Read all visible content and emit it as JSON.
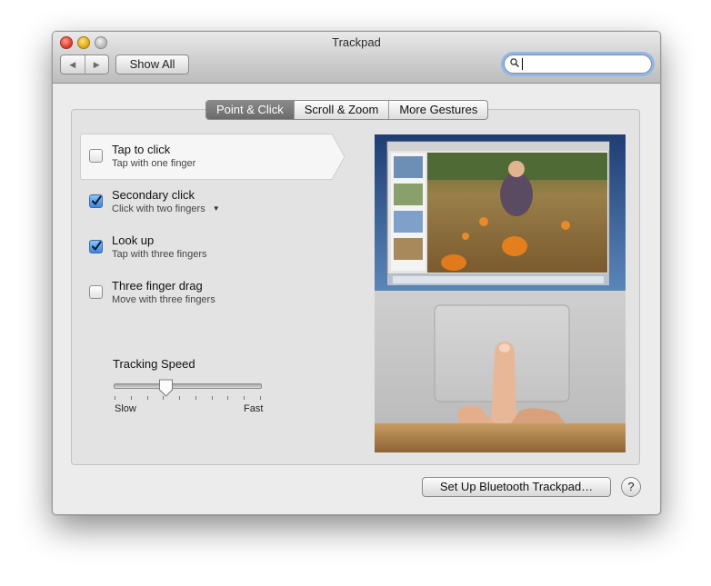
{
  "window": {
    "title": "Trackpad"
  },
  "toolbar": {
    "back_label": "◀",
    "forward_label": "▶",
    "show_all_label": "Show All",
    "search_value": "",
    "search_placeholder": ""
  },
  "tabs": [
    {
      "label": "Point & Click",
      "selected": true
    },
    {
      "label": "Scroll & Zoom",
      "selected": false
    },
    {
      "label": "More Gestures",
      "selected": false
    }
  ],
  "options": [
    {
      "title": "Tap to click",
      "subtitle": "Tap with one finger",
      "checked": false,
      "has_dropdown": false
    },
    {
      "title": "Secondary click",
      "subtitle": "Click with two fingers",
      "checked": true,
      "has_dropdown": true
    },
    {
      "title": "Look up",
      "subtitle": "Tap with three fingers",
      "checked": true,
      "has_dropdown": false
    },
    {
      "title": "Three finger drag",
      "subtitle": "Move with three fingers",
      "checked": false,
      "has_dropdown": false
    }
  ],
  "tracking": {
    "label": "Tracking Speed",
    "min_label": "Slow",
    "max_label": "Fast",
    "value_fraction": 0.35,
    "tick_count": 10
  },
  "footer": {
    "bluetooth_button_label": "Set Up Bluetooth Trackpad…",
    "help_label": "?"
  },
  "colors": {
    "checkbox_checked": "#3f86d8",
    "search_focus": "#8fb7ec",
    "selected_tab": "#6b6b6b"
  }
}
